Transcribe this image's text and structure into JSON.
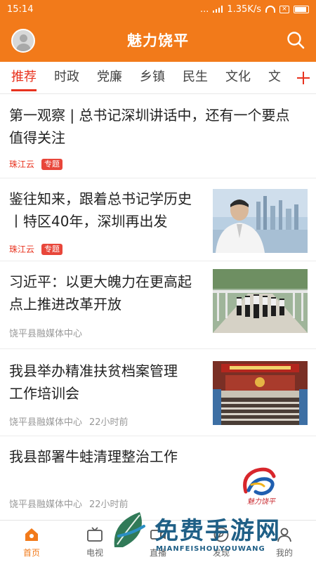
{
  "status_bar": {
    "time": "15:14",
    "dots": "...",
    "speed": "1.35K/s"
  },
  "header": {
    "title": "魅力饶平",
    "avatar_icon": "avatar-icon",
    "search_icon": "search-icon"
  },
  "tabs": [
    {
      "label": "推荐",
      "active": true
    },
    {
      "label": "时政"
    },
    {
      "label": "党廉"
    },
    {
      "label": "乡镇"
    },
    {
      "label": "民生"
    },
    {
      "label": "文化"
    },
    {
      "label": "文"
    }
  ],
  "feed": [
    {
      "title_line1": "第一观察 | 总书记深圳讲话中，还有一个要点",
      "title_line2": "值得关注",
      "source": "珠江云",
      "tag": "专题"
    },
    {
      "title_line1": "鉴往知来，跟着总书记学历史",
      "title_line2": "丨特区40年，深圳再出发",
      "source": "珠江云",
      "tag": "专题"
    },
    {
      "title_line1": "习近平：以更大魄力在更高起",
      "title_line2": "点上推进改革开放",
      "source": "饶平县融媒体中心"
    },
    {
      "title_line1": "我县举办精准扶贫档案管理",
      "title_line2": "工作培训会",
      "source": "饶平县融媒体中心",
      "time": "22小时前"
    },
    {
      "title_line1": "我县部署牛蛙清理整治工作",
      "source": "饶平县融媒体中心",
      "time": "22小时前"
    }
  ],
  "bottom_nav": [
    {
      "label": "首页",
      "active": true,
      "icon": "home-icon"
    },
    {
      "label": "电视",
      "icon": "tv-icon"
    },
    {
      "label": "直播",
      "icon": "live-icon"
    },
    {
      "label": "发现",
      "icon": "discover-icon"
    },
    {
      "label": "我的",
      "icon": "profile-icon"
    }
  ],
  "logo_text": "魅力饶平",
  "watermark": {
    "title": "免费手游网",
    "subtitle": "MIANFEISHOUYOUWANG"
  },
  "colors": {
    "brand_orange": "#f27a1a",
    "accent_red": "#e8321e",
    "tag_red": "#e8463a"
  }
}
